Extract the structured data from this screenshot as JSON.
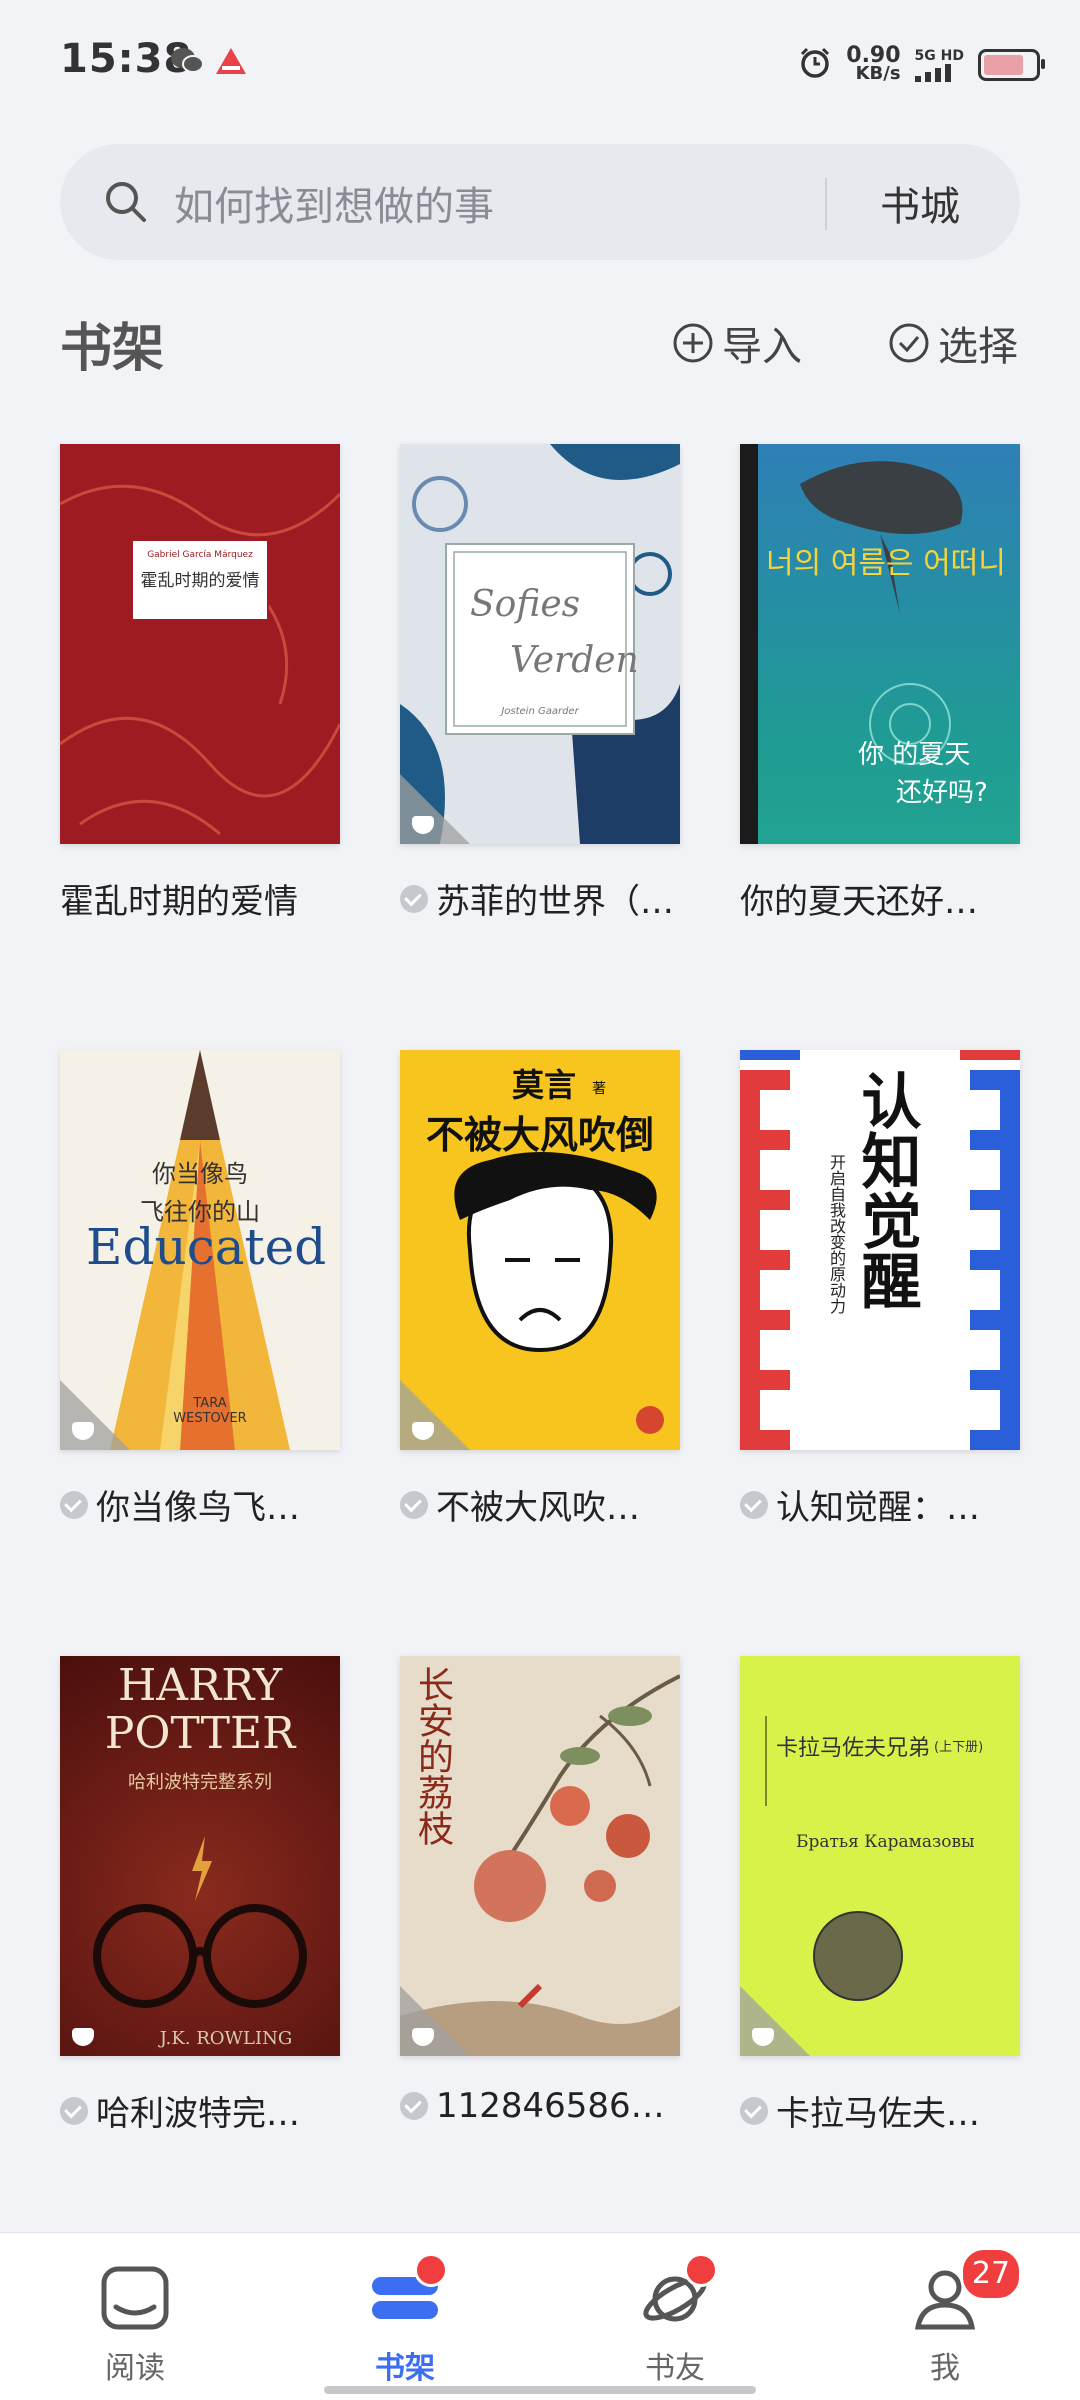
{
  "status_bar": {
    "time": "15:38",
    "net_speed_value": "0.90",
    "net_speed_unit": "KB/s",
    "network_type": "5G HD"
  },
  "search": {
    "placeholder": "如何找到想做的事",
    "store_label": "书城"
  },
  "header": {
    "title": "书架",
    "import_label": "导入",
    "select_label": "选择"
  },
  "cover_text": {
    "b1": {
      "author_en": "Gabriel García Márquez",
      "title": "霍乱时期的爱情"
    },
    "b2": {
      "line1": "Sofies",
      "line2": "Verden",
      "author": "Jostein Gaarder"
    },
    "b3": {
      "kr_title": "너의 여름은 어떠니",
      "line1": "你  的夏天",
      "line2": "还好吗?"
    },
    "b4": {
      "line1": "你当像鸟",
      "line2": "飞往你的山",
      "en": "Educated",
      "author": "TARA WESTOVER"
    },
    "b5": {
      "author": "莫言",
      "author_suffix": "著",
      "title": "不被大风吹倒"
    },
    "b6": {
      "title": "认知觉醒",
      "subtitle": "开启自我改变的原动力"
    },
    "b7": {
      "line1": "HARRY",
      "line2": "POTTER",
      "cn": "哈利波特完整系列",
      "author": "J.K. ROWLING"
    },
    "b8": {
      "title": "长安的荔枝"
    },
    "b9": {
      "cn": "卡拉马佐夫兄弟",
      "cn_sub": "(上下册)",
      "ru": "Братья Карамазовы"
    }
  },
  "books": [
    {
      "title": "霍乱时期的爱情",
      "checked": false
    },
    {
      "title": "苏菲的世界（…",
      "checked": true
    },
    {
      "title": "你的夏天还好…",
      "checked": false
    },
    {
      "title": "你当像鸟飞…",
      "checked": true
    },
    {
      "title": "不被大风吹…",
      "checked": true
    },
    {
      "title": "认知觉醒：…",
      "checked": true
    },
    {
      "title": "哈利波特完…",
      "checked": true
    },
    {
      "title": "112846586…",
      "checked": true
    },
    {
      "title": "卡拉马佐夫…",
      "checked": true
    }
  ],
  "bottom_nav": {
    "items": [
      {
        "label": "阅读"
      },
      {
        "label": "书架"
      },
      {
        "label": "书友"
      },
      {
        "label": "我",
        "badge": "27"
      }
    ]
  },
  "colors": {
    "accent": "#3b6ef0",
    "badge_red": "#f03d3d",
    "background": "#f2f3f7"
  }
}
